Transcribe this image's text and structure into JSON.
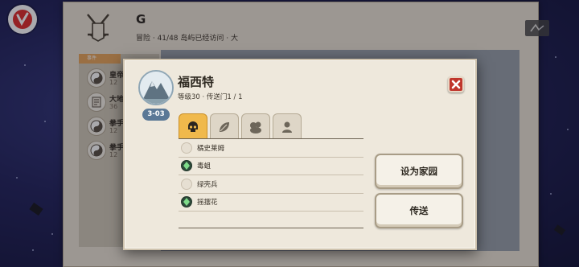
{
  "background": {
    "player_name": "G",
    "player_subtitle": "冒险 · 41/48 岛屿已经访问 · 大",
    "events_tab_label": "事件",
    "events": [
      {
        "title": "皇帝",
        "sub": "12"
      },
      {
        "title": "大地",
        "sub": "36"
      },
      {
        "title": "拳手",
        "sub": "12"
      },
      {
        "title": "拳手",
        "sub": "12"
      }
    ]
  },
  "dialog": {
    "island_name": "福西特",
    "island_meta": "等级30 · 传送门1 / 1",
    "island_code": "3-03",
    "tabs": [
      {
        "name": "skull-icon",
        "active": true
      },
      {
        "name": "leaf-icon",
        "active": false
      },
      {
        "name": "beast-icon",
        "active": false
      },
      {
        "name": "person-icon",
        "active": false
      }
    ],
    "creatures": [
      {
        "name": "橘史莱姆",
        "found": false
      },
      {
        "name": "毒蛆",
        "found": true
      },
      {
        "name": "绿壳兵",
        "found": false
      },
      {
        "name": "摇摆花",
        "found": true
      }
    ],
    "set_home_label": "设为家园",
    "teleport_label": "传送"
  },
  "colors": {
    "accent_tab": "#f0b94c",
    "close_button": "#c0362c",
    "island_code_badge": "#5a7896"
  }
}
